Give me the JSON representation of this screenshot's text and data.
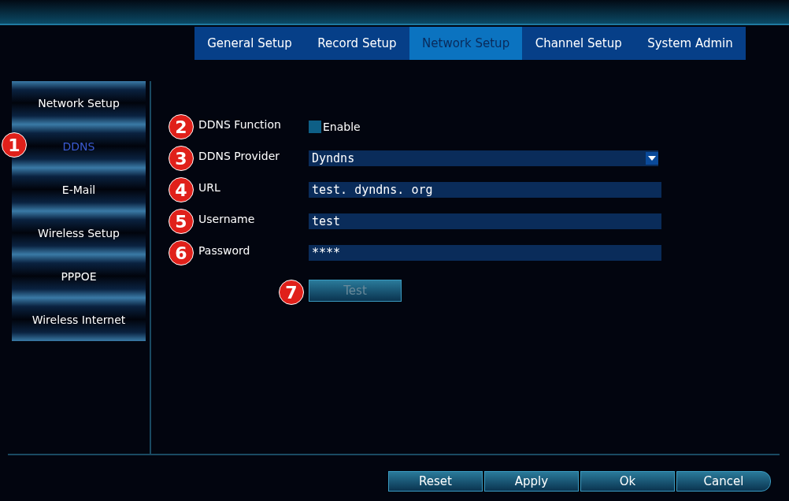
{
  "tabs": [
    {
      "label": "General Setup",
      "selected": false
    },
    {
      "label": "Record Setup",
      "selected": false
    },
    {
      "label": "Network Setup",
      "selected": true
    },
    {
      "label": "Channel Setup",
      "selected": false
    },
    {
      "label": "System Admin",
      "selected": false
    }
  ],
  "sidebar": {
    "items": [
      {
        "label": "Network Setup",
        "selected": false
      },
      {
        "label": "DDNS",
        "selected": true,
        "callout": "1"
      },
      {
        "label": "E-Mail",
        "selected": false
      },
      {
        "label": "Wireless Setup",
        "selected": false
      },
      {
        "label": "PPPOE",
        "selected": false
      },
      {
        "label": "Wireless Internet",
        "selected": false
      }
    ]
  },
  "form": {
    "rows": [
      {
        "kind": "checkbox",
        "callout": "2",
        "label": "DDNS Function",
        "option": "Enable",
        "checked": false
      },
      {
        "kind": "dropdown",
        "callout": "3",
        "label": "DDNS Provider",
        "value": "Dyndns"
      },
      {
        "kind": "text",
        "callout": "4",
        "label": "URL",
        "value": "test. dyndns. org"
      },
      {
        "kind": "text",
        "callout": "5",
        "label": "Username",
        "value": "test"
      },
      {
        "kind": "text",
        "callout": "6",
        "label": "Password",
        "value": "****"
      }
    ],
    "test_button": {
      "label": "Test",
      "callout": "7",
      "disabled": true
    }
  },
  "buttons": [
    "Reset",
    "Apply",
    "Ok",
    "Cancel"
  ]
}
